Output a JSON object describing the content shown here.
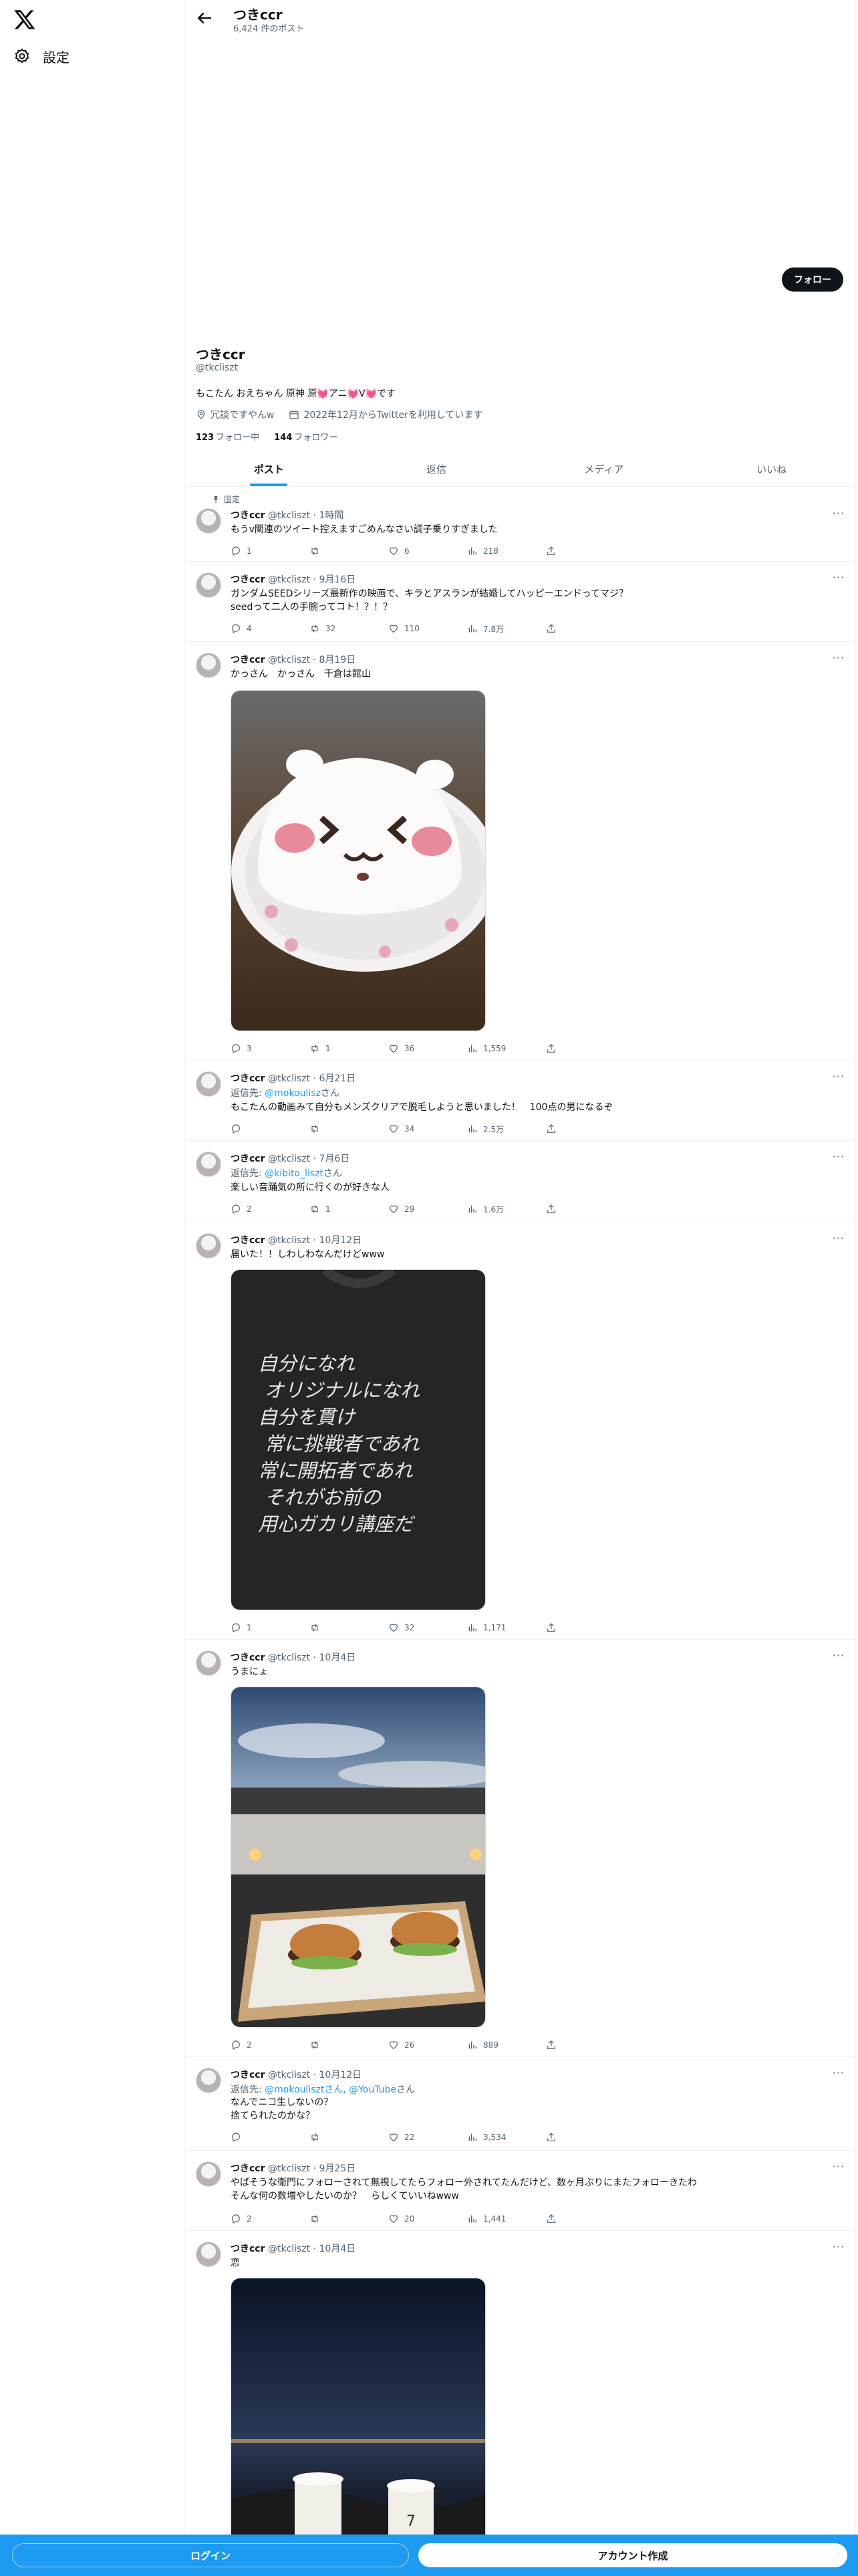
{
  "sidebar": {
    "settings_label": "設定"
  },
  "header": {
    "name": "つきccr",
    "post_count": "6,424 件のポスト"
  },
  "profile": {
    "follow_label": "フォロー",
    "name": "つきccr",
    "handle": "@tkcliszt",
    "bio_1": "もこたん おえちゃん 原神 原",
    "bio_heart_1": "💓",
    "bio_2": "アニ",
    "bio_heart_2": "💓",
    "bio_3": "V",
    "bio_heart_3": "💓",
    "bio_4": "です",
    "location": "冗談ですやんw",
    "joined": "2022年12月からTwitterを利用しています",
    "following_count": "123",
    "following_label": "フォロー中",
    "followers_count": "144",
    "followers_label": "フォロワー"
  },
  "tabs": [
    {
      "label": "ポスト"
    },
    {
      "label": "返信"
    },
    {
      "label": "メディア"
    },
    {
      "label": "いいね"
    }
  ],
  "pinned_label": "固定",
  "tweets": [
    {
      "name": "つきccr",
      "meta": "@tkcliszt · 1時間",
      "text": "もうv関連のツイート控えますごめんなさい調子乗りすぎました",
      "reply": "",
      "views": "218",
      "replies": "1",
      "retweets": "",
      "likes": "6"
    },
    {
      "name": "つきccr",
      "meta": "@tkcliszt · 9月16日",
      "text": "ガンダムSEEDシリーズ最新作の映画で、キラとアスランが結婚してハッピーエンドってマジ？\nseedって二人の手腕ってコト！？！？",
      "reply": "",
      "views": "7.8万",
      "replies": "4",
      "retweets": "32",
      "likes": "110"
    },
    {
      "name": "つきccr",
      "meta": "@tkcliszt · 8月19日",
      "text": "かっさん　かっさん　千倉は館山",
      "reply": "",
      "views": "1,559",
      "replies": "3",
      "retweets": "1",
      "likes": "36"
    },
    {
      "name": "つきccr",
      "meta": "@tkcliszt · 6月21日",
      "text": "もこたんの動画みて自分もメンズクリアで脱毛しようと思いました！　100点の男になるぞ",
      "reply_prefix": "返信先: ",
      "reply_link": "@mokoulisz",
      "reply_suffix": "さん",
      "views": "2.5万",
      "replies": "",
      "retweets": "",
      "likes": "34"
    },
    {
      "name": "つきccr",
      "meta": "@tkcliszt · 7月6日",
      "text": "楽しい音踊気の所に行くのが好きな人",
      "reply_prefix": "返信先: ",
      "reply_link": "@kibito_liszt",
      "reply_suffix": "さん",
      "views": "1.6万",
      "replies": "2",
      "retweets": "1",
      "likes": "29"
    },
    {
      "name": "つきccr",
      "meta": "@tkcliszt · 10月12日",
      "text": "届いた！！しわしわなんだけどwww",
      "reply": "",
      "views": "1,171",
      "replies": "1",
      "retweets": "",
      "likes": "32"
    },
    {
      "name": "つきccr",
      "meta": "@tkcliszt · 10月4日",
      "text": "うまにょ",
      "reply": "",
      "views": "889",
      "replies": "2",
      "retweets": "",
      "likes": "26"
    },
    {
      "name": "つきccr",
      "meta": "@tkcliszt · 10月12日",
      "text": "なんでニコ生しないの？\n捨てられたのかな？",
      "reply_prefix": "返信先: ",
      "reply_link": "@mokoulisztさん, @YouTube",
      "reply_suffix": "さん",
      "views": "3,534",
      "replies": "",
      "retweets": "",
      "likes": "22"
    },
    {
      "name": "つきccr",
      "meta": "@tkcliszt · 9月25日",
      "text": "やばそうな衛門にフォローされて無視してたらフォロー外されてたんだけど、数ヶ月ぶりにまたフォローきたわ\nそんな何の数増やしたいのか？　らしくていいねwww",
      "reply": "",
      "views": "1,441",
      "replies": "2",
      "retweets": "",
      "likes": "20"
    },
    {
      "name": "つきccr",
      "meta": "@tkcliszt · 10月4日",
      "text": "恋",
      "reply": "",
      "views": "",
      "replies": "",
      "retweets": "",
      "likes": ""
    }
  ],
  "tshirt_text": [
    "自分になれ",
    "オリジナルになれ",
    "自分を貫け",
    "常に挑戦者であれ",
    "常に開拓者であれ",
    "それがお前の",
    "用心ガカリ講座だ"
  ],
  "bottom": {
    "login_label": "ログイン",
    "signup_label": "アカウント作成"
  },
  "colors": {
    "accent": "#1d9bf0",
    "text": "#0f1419",
    "muted": "#536471",
    "like": "#f91880"
  }
}
